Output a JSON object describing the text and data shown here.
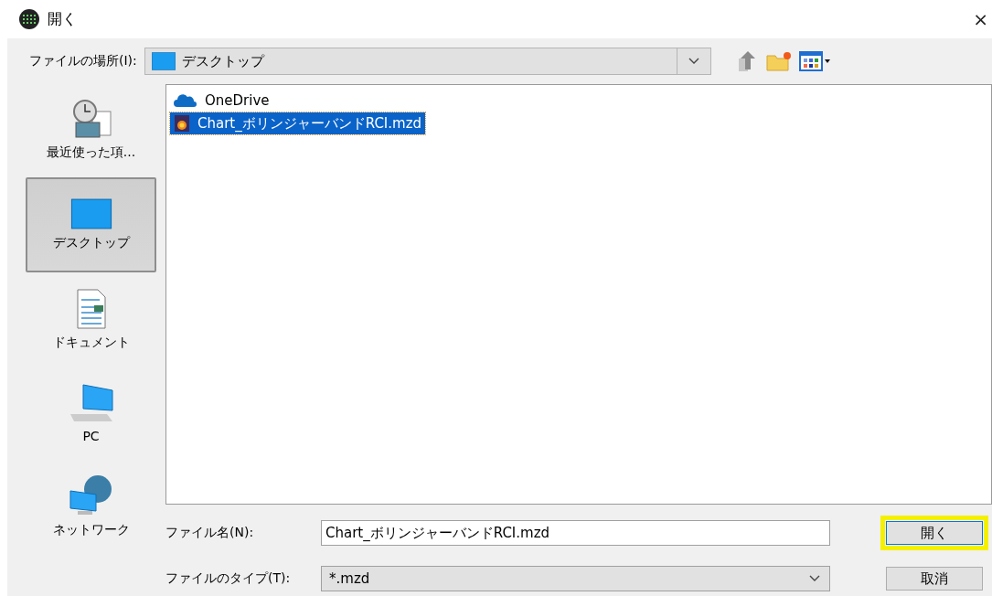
{
  "window": {
    "title": "開く",
    "close": "×"
  },
  "location": {
    "label": "ファイルの場所(I):",
    "value": "デスクトップ"
  },
  "sidebar": {
    "items": [
      {
        "label": "最近使った項...",
        "kind": "recent",
        "selected": false
      },
      {
        "label": "デスクトップ",
        "kind": "desktop",
        "selected": true
      },
      {
        "label": "ドキュメント",
        "kind": "documents",
        "selected": false
      },
      {
        "label": "PC",
        "kind": "pc",
        "selected": false
      },
      {
        "label": "ネットワーク",
        "kind": "network",
        "selected": false
      }
    ]
  },
  "files": [
    {
      "name": "OneDrive",
      "kind": "cloud",
      "selected": false
    },
    {
      "name": "Chart_ボリンジャーバンドRCI.mzd",
      "kind": "chart",
      "selected": true
    }
  ],
  "filename": {
    "label": "ファイル名(N):",
    "value": "Chart_ボリンジャーバンドRCI.mzd"
  },
  "filetype": {
    "label": "ファイルのタイプ(T):",
    "value": "*.mzd"
  },
  "buttons": [
    {
      "label": "開く",
      "highlighted": true
    },
    {
      "label": "取消",
      "highlighted": false
    }
  ]
}
